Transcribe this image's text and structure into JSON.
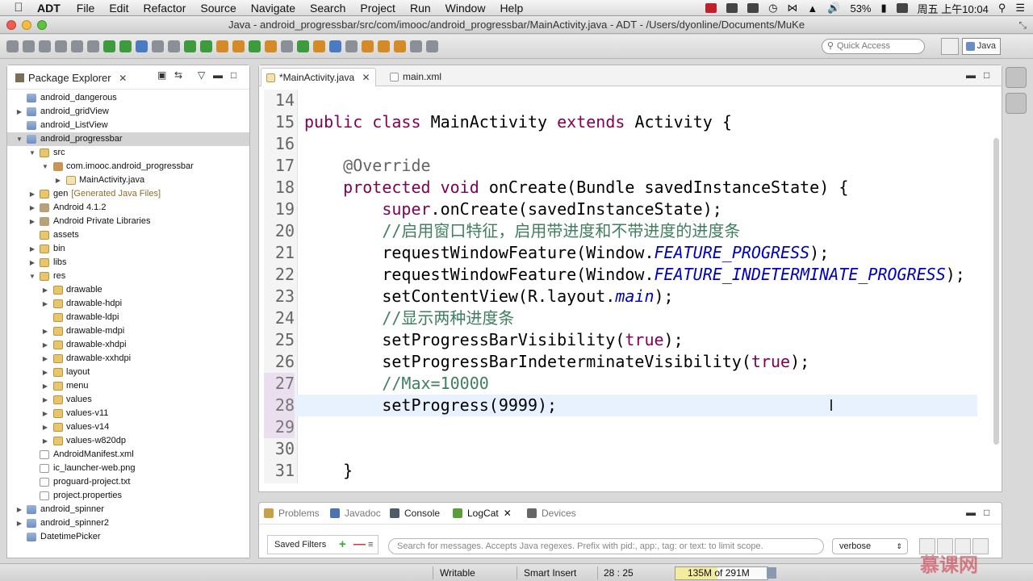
{
  "menubar": {
    "app": "ADT",
    "items": [
      "File",
      "Edit",
      "Refactor",
      "Source",
      "Navigate",
      "Search",
      "Project",
      "Run",
      "Window",
      "Help"
    ],
    "battery": "53%",
    "clock": "周五 上午10:04"
  },
  "window": {
    "title": "Java - android_progressbar/src/com/imooc/android_progressbar/MainActivity.java - ADT - /Users/dyonline/Documents/MuKe"
  },
  "toolbar": {
    "quick_access_placeholder": "Quick Access",
    "perspective": "Java"
  },
  "package_explorer": {
    "title": "Package Explorer",
    "items": [
      {
        "label": "android_dangerous",
        "extra": ""
      },
      {
        "label": "android_gridView",
        "extra": ""
      },
      {
        "label": "android_ListView",
        "extra": ""
      },
      {
        "label": "android_progressbar",
        "extra": ""
      },
      {
        "label": "src",
        "extra": ""
      },
      {
        "label": "com.imooc.android_progressbar",
        "extra": ""
      },
      {
        "label": "MainActivity.java",
        "extra": ""
      },
      {
        "label": "gen",
        "extra": "[Generated Java Files]"
      },
      {
        "label": "Android 4.1.2",
        "extra": ""
      },
      {
        "label": "Android Private Libraries",
        "extra": ""
      },
      {
        "label": "assets",
        "extra": ""
      },
      {
        "label": "bin",
        "extra": ""
      },
      {
        "label": "libs",
        "extra": ""
      },
      {
        "label": "res",
        "extra": ""
      },
      {
        "label": "drawable",
        "extra": ""
      },
      {
        "label": "drawable-hdpi",
        "extra": ""
      },
      {
        "label": "drawable-ldpi",
        "extra": ""
      },
      {
        "label": "drawable-mdpi",
        "extra": ""
      },
      {
        "label": "drawable-xhdpi",
        "extra": ""
      },
      {
        "label": "drawable-xxhdpi",
        "extra": ""
      },
      {
        "label": "layout",
        "extra": ""
      },
      {
        "label": "menu",
        "extra": ""
      },
      {
        "label": "values",
        "extra": ""
      },
      {
        "label": "values-v11",
        "extra": ""
      },
      {
        "label": "values-v14",
        "extra": ""
      },
      {
        "label": "values-w820dp",
        "extra": ""
      },
      {
        "label": "AndroidManifest.xml",
        "extra": ""
      },
      {
        "label": "ic_launcher-web.png",
        "extra": ""
      },
      {
        "label": "proguard-project.txt",
        "extra": ""
      },
      {
        "label": "project.properties",
        "extra": ""
      },
      {
        "label": "android_spinner",
        "extra": ""
      },
      {
        "label": "android_spinner2",
        "extra": ""
      },
      {
        "label": "DatetimePicker",
        "extra": ""
      }
    ]
  },
  "editor": {
    "tabs": [
      {
        "label": "*MainActivity.java"
      },
      {
        "label": "main.xml"
      }
    ],
    "lines": [
      {
        "n": "14",
        "code": ""
      },
      {
        "n": "15",
        "code": "public class MainActivity extends Activity {"
      },
      {
        "n": "16",
        "code": ""
      },
      {
        "n": "17",
        "code": "    @Override"
      },
      {
        "n": "18",
        "code": "    protected void onCreate(Bundle savedInstanceState) {"
      },
      {
        "n": "19",
        "code": "        super.onCreate(savedInstanceState);"
      },
      {
        "n": "20",
        "code": "        //启用窗口特征，启用带进度和不带进度的进度条"
      },
      {
        "n": "21",
        "code": "        requestWindowFeature(Window.FEATURE_PROGRESS);"
      },
      {
        "n": "22",
        "code": "        requestWindowFeature(Window.FEATURE_INDETERMINATE_PROGRESS);"
      },
      {
        "n": "23",
        "code": "        setContentView(R.layout.main);"
      },
      {
        "n": "24",
        "code": "        //显示两种进度条"
      },
      {
        "n": "25",
        "code": "        setProgressBarVisibility(true);"
      },
      {
        "n": "26",
        "code": "        setProgressBarIndeterminateVisibility(true);"
      },
      {
        "n": "27",
        "code": "        //Max=10000"
      },
      {
        "n": "28",
        "code": "        setProgress(9999);"
      },
      {
        "n": "29",
        "code": ""
      },
      {
        "n": "30",
        "code": ""
      },
      {
        "n": "31",
        "code": "    }"
      }
    ]
  },
  "bottom": {
    "tabs": [
      {
        "label": "Problems"
      },
      {
        "label": "Javadoc"
      },
      {
        "label": "Console"
      },
      {
        "label": "LogCat"
      },
      {
        "label": "Devices"
      }
    ],
    "saved_filters": "Saved Filters",
    "search_placeholder": "Search for messages. Accepts Java regexes. Prefix with pid:, app:, tag: or text: to limit scope.",
    "level": "verbose"
  },
  "status": {
    "writable": "Writable",
    "insert_mode": "Smart Insert",
    "position": "28 : 25",
    "heap_used": "135M",
    "heap_total": "of 291M",
    "heap_fraction": 0.46
  },
  "watermark": "慕课网",
  "colors": {
    "keyword": "#7f0055",
    "comment": "#3f7f5f",
    "constant": "#0000c0",
    "annotation": "#646464",
    "current_line": "#e8f2fe"
  }
}
